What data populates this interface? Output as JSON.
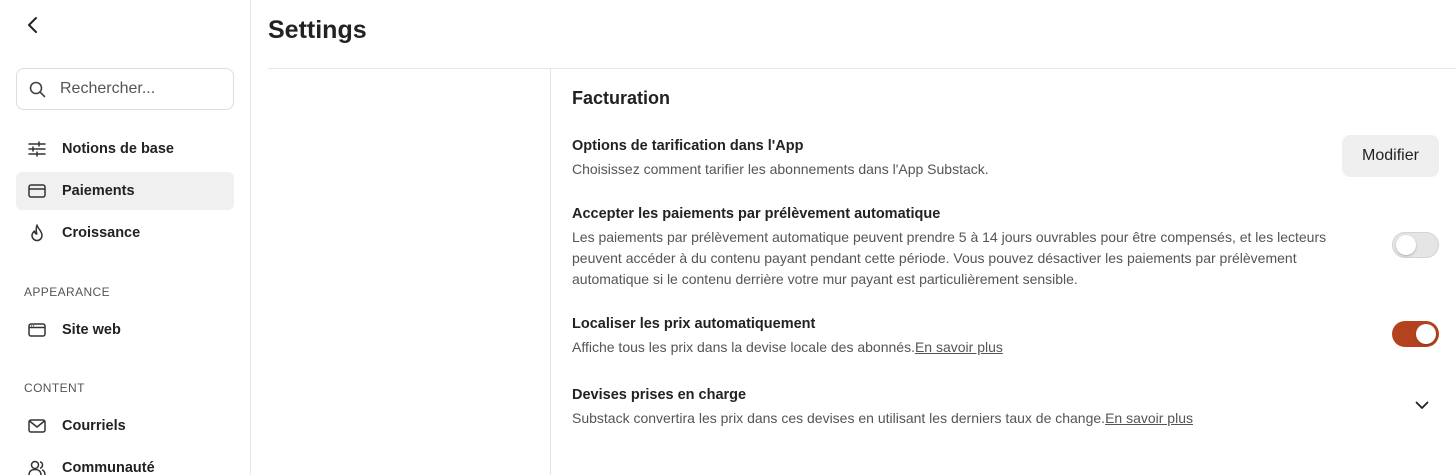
{
  "sidebar": {
    "search_placeholder": "Rechercher...",
    "items_top": [
      {
        "label": "Notions de base",
        "icon": "sliders-icon"
      },
      {
        "label": "Paiements",
        "icon": "credit-card-icon",
        "active": true
      },
      {
        "label": "Croissance",
        "icon": "flame-icon"
      }
    ],
    "section_appearance": "APPEARANCE",
    "items_appearance": [
      {
        "label": "Site web",
        "icon": "browser-window-icon"
      }
    ],
    "section_content": "CONTENT",
    "items_content": [
      {
        "label": "Courriels",
        "icon": "mail-icon"
      },
      {
        "label": "Communauté",
        "icon": "users-icon"
      }
    ]
  },
  "header": {
    "title": "Settings"
  },
  "billing": {
    "section_title": "Facturation",
    "in_app_pricing": {
      "title": "Options de tarification dans l'App",
      "description": "Choisissez comment tarifier les abonnements dans l'App Substack.",
      "button_label": "Modifier"
    },
    "direct_debit": {
      "title": "Accepter les paiements par prélèvement automatique",
      "description": "Les paiements par prélèvement automatique peuvent prendre 5 à 14 jours ouvrables pour être compensés, et les lecteurs peuvent accéder à du contenu payant pendant cette période. Vous pouvez désactiver les paiements par prélèvement automatique si le contenu derrière votre mur payant est particulièrement sensible.",
      "enabled": false
    },
    "localize_prices": {
      "title": "Localiser les prix automatiquement",
      "description": "Affiche tous les prix dans la devise locale des abonnés.",
      "link": "En savoir plus",
      "enabled": true
    },
    "currencies": {
      "title": "Devises prises en charge",
      "description": "Substack convertira les prix dans ces devises en utilisant les derniers taux de change.",
      "link": "En savoir plus"
    }
  },
  "colors": {
    "accent": "#b5421e",
    "active_nav_bg": "#f0f0f0",
    "border": "#e6e6e6"
  }
}
